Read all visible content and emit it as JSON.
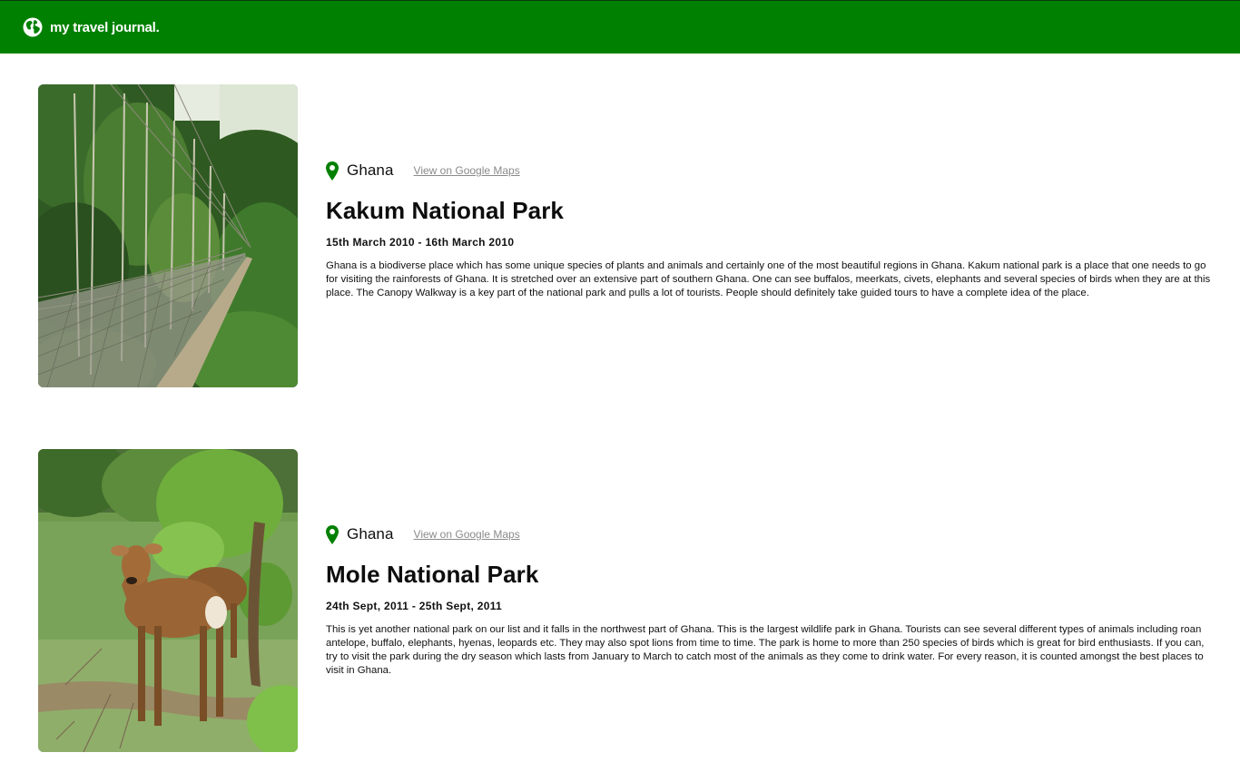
{
  "header": {
    "icon": "globe-icon",
    "brand": "my travel journal.",
    "background": "#008000"
  },
  "entries": [
    {
      "image": "canopy-walkway-photo",
      "location_icon": "map-pin-icon",
      "location": "Ghana",
      "maps_link": "View on Google Maps",
      "title": "Kakum National Park",
      "dates": "15th March 2010 - 16th March 2010",
      "description": "Ghana is a biodiverse place which has some unique species of plants and animals and certainly one of the most beautiful regions in Ghana. Kakum national park is a place that one needs to go for visiting the rainforests of Ghana. It is stretched over an extensive part of southern Ghana. One can see buffalos, meerkats, civets, elephants and several species of birds when they are at this place. The Canopy Walkway is a key part of the national park and pulls a lot of tourists. People should definitely take guided tours to have a complete idea of the place."
    },
    {
      "image": "waterbuck-photo",
      "location_icon": "map-pin-icon",
      "location": "Ghana",
      "maps_link": "View on Google Maps",
      "title": "Mole National Park",
      "dates": "24th Sept, 2011 - 25th Sept, 2011",
      "description": "This is yet another national park on our list and it falls in the northwest part of Ghana. This is the largest wildlife park in Ghana. Tourists can see several different types of animals including roan antelope, buffalo, elephants, hyenas, leopards etc. They may also spot lions from time to time. The park is home to more than 250 species of birds which is great for bird enthusiasts. If you can, try to visit the park during the dry season which lasts from January to March to catch most of the animals as they come to drink water. For every reason, it is counted amongst the best places to visit in Ghana."
    }
  ],
  "colors": {
    "accent": "#008000",
    "link": "#8a8a8a"
  }
}
